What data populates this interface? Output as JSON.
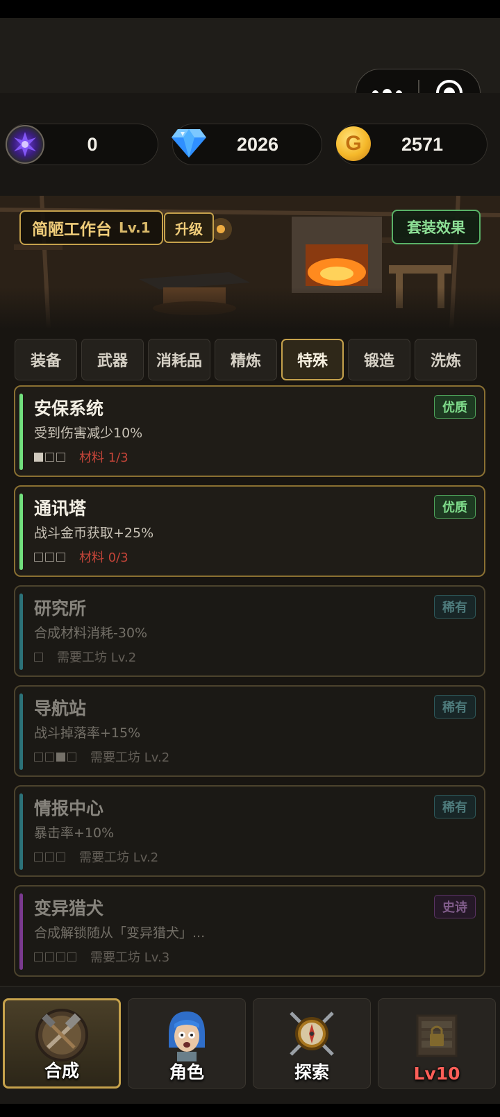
{
  "currencies": {
    "crystal": "0",
    "diamond": "2026",
    "gold": "2571"
  },
  "workbench": {
    "name": "简陋工作台",
    "level": "Lv.1",
    "upgrade_label": "升级",
    "set_effect_label": "套装效果"
  },
  "tabs": [
    {
      "label": "装备"
    },
    {
      "label": "武器"
    },
    {
      "label": "消耗品"
    },
    {
      "label": "精炼"
    },
    {
      "label": "特殊"
    },
    {
      "label": "锻造"
    },
    {
      "label": "洗炼"
    }
  ],
  "active_tab": "特殊",
  "items": [
    {
      "title": "安保系统",
      "desc": "受到伤害减少10%",
      "badge": "优质",
      "status": "材料 1/3"
    },
    {
      "title": "通讯塔",
      "desc": "战斗金币获取+25%",
      "badge": "优质",
      "status": "材料 0/3"
    },
    {
      "title": "研究所",
      "desc": "合成材料消耗-30%",
      "badge": "稀有",
      "status": "需要工坊 Lv.2"
    },
    {
      "title": "导航站",
      "desc": "战斗掉落率+15%",
      "badge": "稀有",
      "status": "需要工坊 Lv.2"
    },
    {
      "title": "情报中心",
      "desc": "暴击率+10%",
      "badge": "稀有",
      "status": "需要工坊 Lv.2"
    },
    {
      "title": "变异猎犬",
      "desc": "合成解锁随从「变异猎犬」...",
      "badge": "史诗",
      "status": "需要工坊 Lv.3"
    }
  ],
  "nav": [
    {
      "label": "合成"
    },
    {
      "label": "角色"
    },
    {
      "label": "探索"
    },
    {
      "label": "Lv10"
    }
  ],
  "colors": {
    "gold_accent": "#c6a24c",
    "quality_green": "#7fdc8b",
    "rare_teal": "#78cbd1",
    "epic_purple": "#d493ea",
    "warning_red": "#c34438"
  },
  "icons": {
    "capsule_menu": "more-dots-icon",
    "capsule_close": "target-icon",
    "crystal": "purple-crystal-icon",
    "diamond": "diamond-icon",
    "gold": "gold-coin-icon",
    "nav_craft": "crafting-tools-icon",
    "nav_character": "character-portrait-icon",
    "nav_explore": "compass-swords-icon",
    "nav_shop": "locked-shop-icon"
  }
}
